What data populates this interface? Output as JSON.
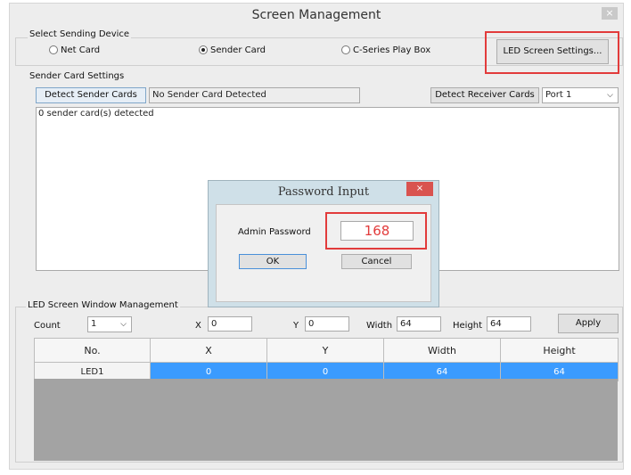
{
  "window": {
    "title": "Screen Management",
    "close_glyph": "×"
  },
  "sending_device": {
    "label": "Select Sending Device",
    "options": [
      "Net Card",
      "Sender Card",
      "C-Series Play Box"
    ],
    "selected": "Sender Card",
    "led_settings_button": "LED Screen Settings..."
  },
  "sender_settings": {
    "label": "Sender Card Settings",
    "detect_sender_button": "Detect Sender Cards",
    "status_text": "No Sender Card Detected",
    "detect_receiver_button": "Detect Receiver Cards",
    "port_value": "Port 1",
    "log_text": "0 sender card(s) detected"
  },
  "dialog": {
    "title": "Password Input",
    "close_glyph": "×",
    "field_label": "Admin Password",
    "password_value": "168",
    "ok_label": "OK",
    "cancel_label": "Cancel"
  },
  "window_mgmt": {
    "label": "LED Screen Window Management",
    "count_label": "Count",
    "count_value": "1",
    "x_label": "X",
    "x_value": "0",
    "y_label": "Y",
    "y_value": "0",
    "width_label": "Width",
    "width_value": "64",
    "height_label": "Height",
    "height_value": "64",
    "apply_label": "Apply",
    "columns": [
      "No.",
      "X",
      "Y",
      "Width",
      "Height"
    ],
    "rows": [
      [
        "LED1",
        "0",
        "0",
        "64",
        "64"
      ]
    ]
  },
  "colors": {
    "highlight_red": "#e23b3b",
    "selected_row": "#3b9bff",
    "dialog_close": "#d9534f"
  }
}
